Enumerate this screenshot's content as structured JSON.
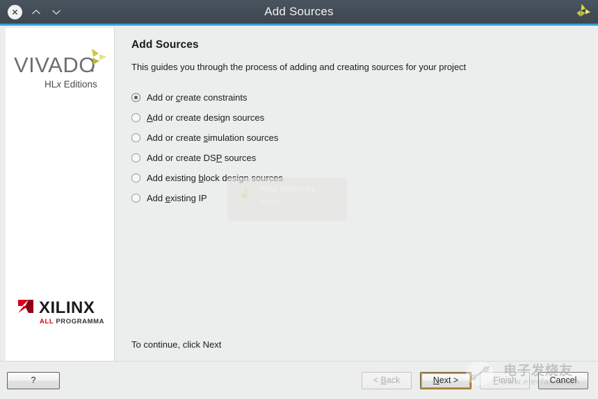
{
  "window": {
    "title": "Add Sources",
    "close_icon": "close-icon",
    "up_icon": "chevron-up-icon",
    "down_icon": "chevron-down-icon",
    "brand_icon": "xilinx-propeller-icon",
    "accent_color": "#2BA6DE",
    "titlebar_color": "#434d57"
  },
  "sidebar": {
    "product_logo_text": "VIVADO",
    "product_logo_sub": "HLx Editions",
    "vendor_logo_text": "XILINX",
    "vendor_logo_sub": "ALL PROGRAMMABLE.",
    "vendor_accent": "#D6001C"
  },
  "main": {
    "title": "Add Sources",
    "subtitle": "This guides you through the process of adding and creating sources for your project",
    "options": [
      {
        "pre": "Add or ",
        "mnemonic": "c",
        "post": "reate constraints",
        "selected": true,
        "name": "radio-add-or-create-constraints"
      },
      {
        "pre": "",
        "mnemonic": "A",
        "post": "dd or create design sources",
        "selected": false,
        "name": "radio-add-or-create-design-sources"
      },
      {
        "pre": "Add or create ",
        "mnemonic": "s",
        "post": "imulation sources",
        "selected": false,
        "name": "radio-add-or-create-simulation-sources"
      },
      {
        "pre": "Add or create DS",
        "mnemonic": "P",
        "post": " sources",
        "selected": false,
        "name": "radio-add-or-create-dsp-sources"
      },
      {
        "pre": "Add existing ",
        "mnemonic": "b",
        "post": "lock design sources",
        "selected": false,
        "name": "radio-add-existing-block-design-sources"
      },
      {
        "pre": "Add ",
        "mnemonic": "e",
        "post": "xisting IP",
        "selected": false,
        "name": "radio-add-existing-ip"
      }
    ],
    "continue_text": "To continue, click Next",
    "ghost": {
      "title": "Add Sources",
      "subtitle": "Vivado"
    }
  },
  "footer": {
    "help_label": "?",
    "back": {
      "pre": "< ",
      "mnemonic": "B",
      "post": "ack",
      "disabled": true
    },
    "next": {
      "pre": "",
      "mnemonic": "N",
      "post": "ext >",
      "disabled": false,
      "is_default": true
    },
    "finish": {
      "pre": "",
      "mnemonic": "F",
      "post": "inish",
      "disabled": true
    },
    "cancel": {
      "label": "Cancel",
      "disabled": false
    }
  },
  "watermark": {
    "text_cn": "电子发烧友",
    "text_url": "www.elecfans.com"
  }
}
